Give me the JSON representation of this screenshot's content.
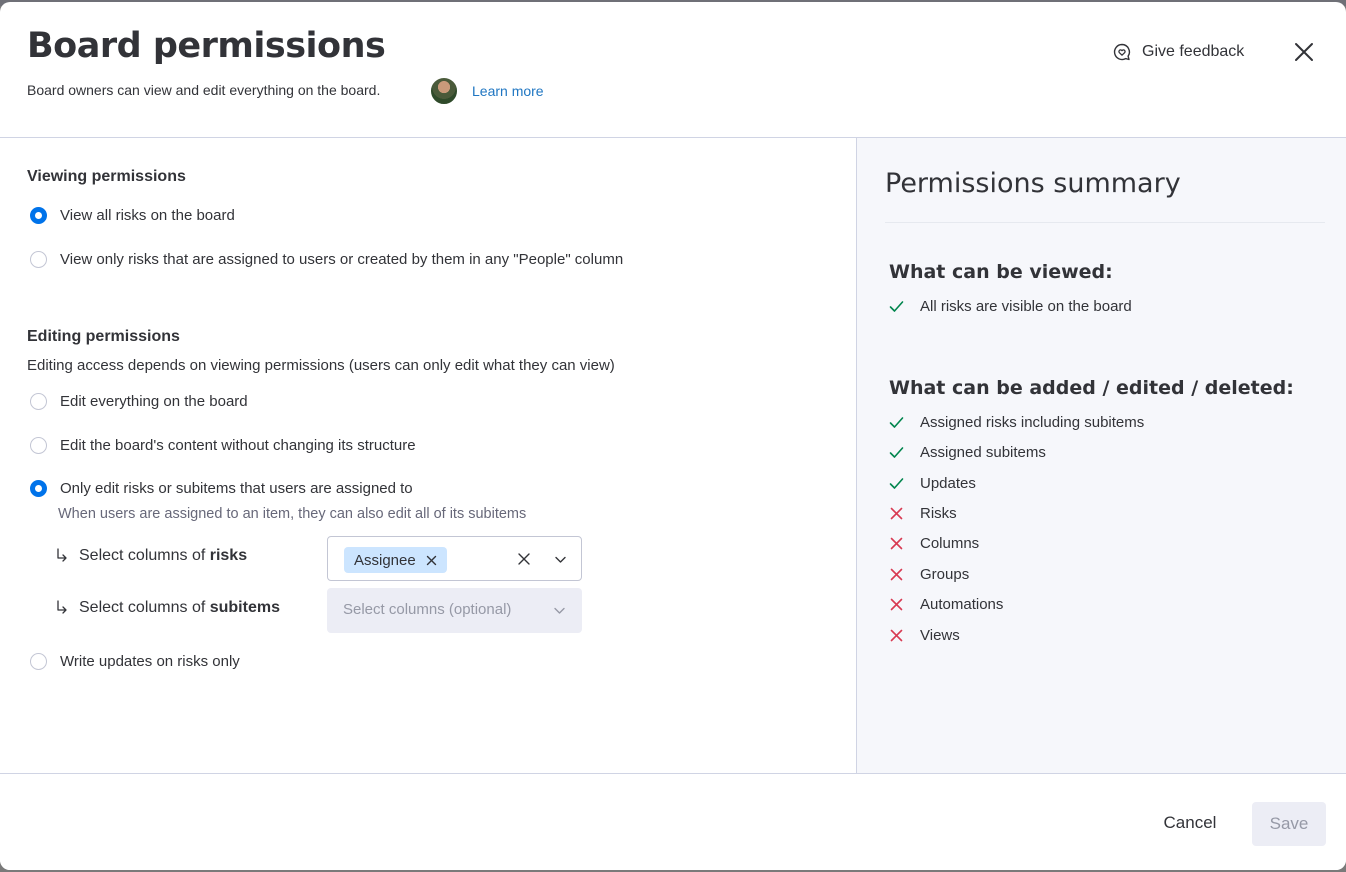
{
  "modal": {
    "title": "Board permissions",
    "subtitle": "Board owners can view and edit everything on the board.",
    "learn_more": "Learn more",
    "feedback": "Give feedback"
  },
  "viewing": {
    "title": "Viewing permissions",
    "options": [
      {
        "label": "View all risks on the board",
        "checked": true
      },
      {
        "label": "View only risks that are assigned to users or created by them in any \"People\" column",
        "checked": false
      }
    ]
  },
  "editing": {
    "title": "Editing permissions",
    "description": "Editing access depends on viewing permissions (users can only edit what they can view)",
    "options": [
      {
        "label": "Edit everything on the board",
        "checked": false
      },
      {
        "label": "Edit the board's content without changing its structure",
        "checked": false
      },
      {
        "label": "Only edit risks or subitems that users are assigned to",
        "checked": true
      },
      {
        "label": "Write updates on risks only",
        "checked": false
      }
    ],
    "hint": "When users are assigned to an item, they can also edit all of its subitems",
    "risks_columns": {
      "prefix": "Select columns of ",
      "bold": "risks",
      "chip": "Assignee"
    },
    "subitems_columns": {
      "prefix": "Select columns of ",
      "bold": "subitems",
      "placeholder": "Select columns (optional)"
    }
  },
  "summary": {
    "title": "Permissions summary",
    "viewed_title": "What can be viewed:",
    "viewed_items": [
      {
        "label": "All risks are visible on the board",
        "allowed": true
      }
    ],
    "edited_title": "What can be added / edited / deleted:",
    "edited_items": [
      {
        "label": "Assigned risks including subitems",
        "allowed": true
      },
      {
        "label": "Assigned subitems",
        "allowed": true
      },
      {
        "label": "Updates",
        "allowed": true
      },
      {
        "label": "Risks",
        "allowed": false
      },
      {
        "label": "Columns",
        "allowed": false
      },
      {
        "label": "Groups",
        "allowed": false
      },
      {
        "label": "Automations",
        "allowed": false
      },
      {
        "label": "Views",
        "allowed": false
      }
    ]
  },
  "footer": {
    "cancel": "Cancel",
    "save": "Save"
  },
  "colors": {
    "accent": "#0073ea",
    "allowed": "#00854d",
    "denied": "#d83a52",
    "link": "#1f76c2"
  }
}
